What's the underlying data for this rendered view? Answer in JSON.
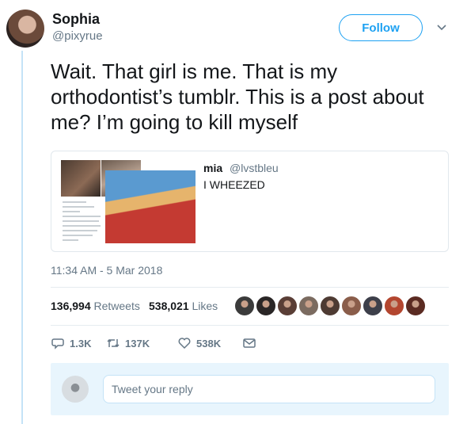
{
  "user": {
    "display_name": "Sophia",
    "handle": "@pixyrue",
    "follow_label": "Follow"
  },
  "tweet": {
    "text": "Wait. That girl is me. That is my orthodontist’s tumblr. This is a post about me? I’m going to kill myself",
    "timestamp": "11:34 AM - 5 Mar 2018"
  },
  "quoted": {
    "name": "mia",
    "handle": "@lvstbleu",
    "text": "I WHEEZED"
  },
  "stats": {
    "retweets_count": "136,994",
    "retweets_label": "Retweets",
    "likes_count": "538,021",
    "likes_label": "Likes"
  },
  "likers": [
    "#3b3b3b",
    "#2a2626",
    "#5a3e36",
    "#7b6b60",
    "#4e3b33",
    "#8a5d4a",
    "#3d3f4a",
    "#b3462f",
    "#5b2b22"
  ],
  "actions": {
    "replies": "1.3K",
    "retweets": "137K",
    "likes": "538K"
  },
  "reply": {
    "placeholder": "Tweet your reply"
  },
  "colors": {
    "accent": "#1da1f2",
    "muted": "#657786",
    "thread_line": "#c4e3f7",
    "reply_bg": "#e8f5fd"
  }
}
